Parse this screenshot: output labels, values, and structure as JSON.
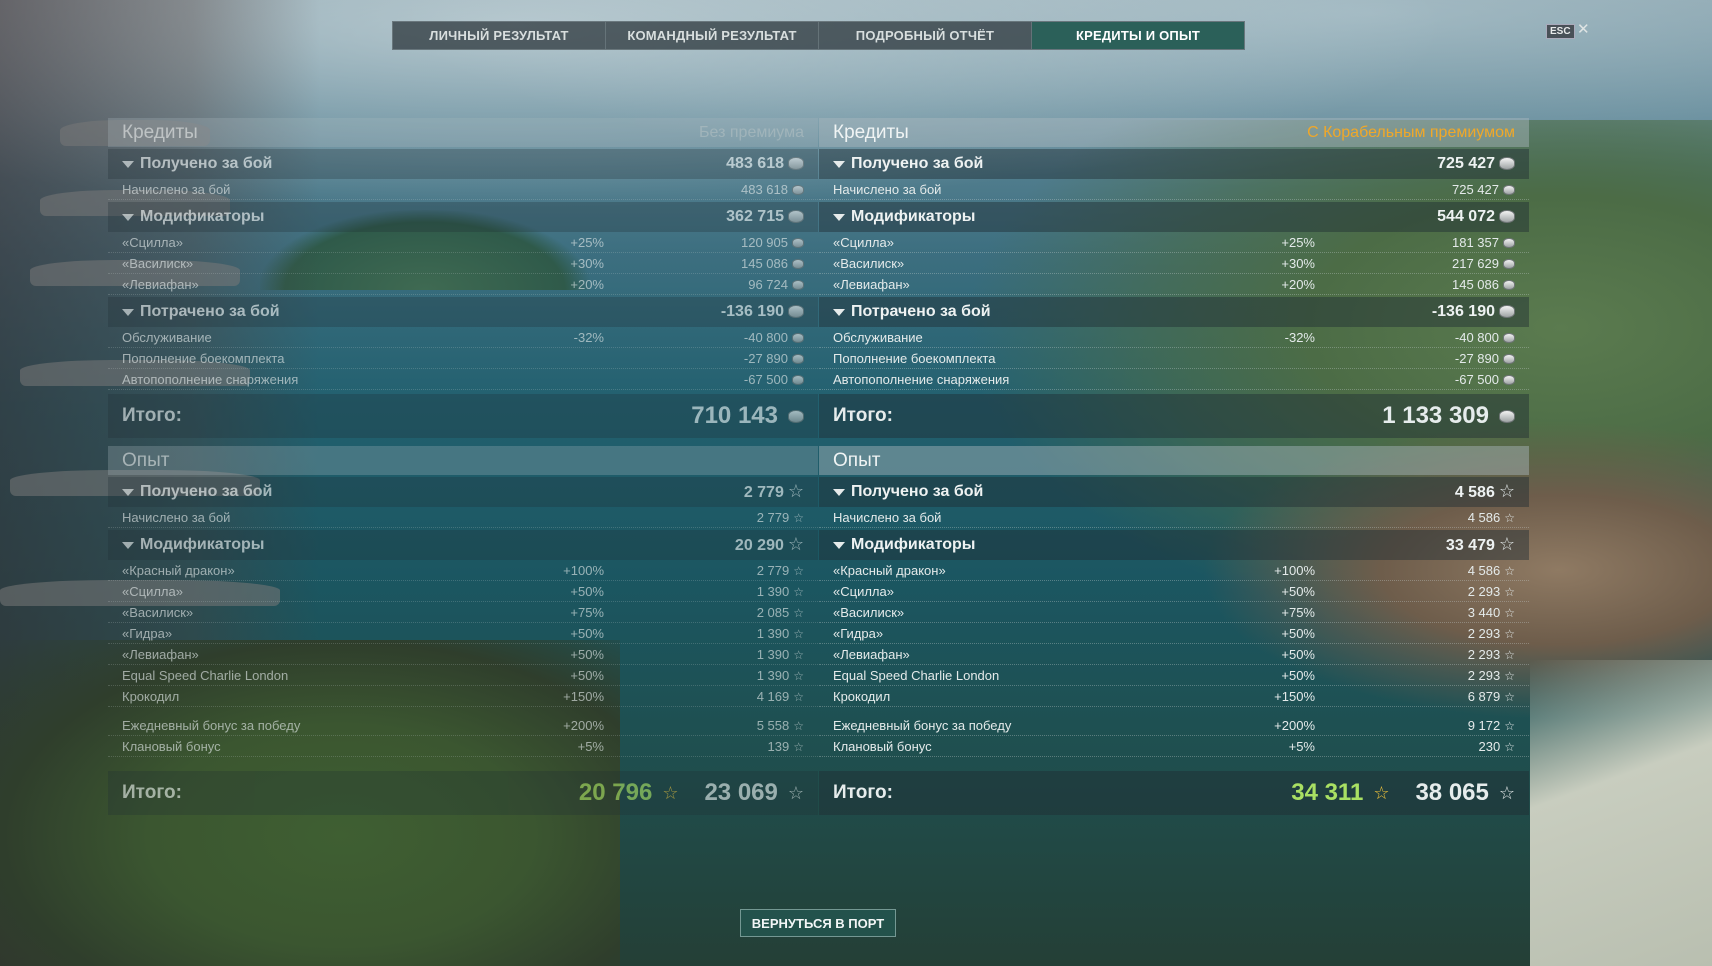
{
  "tabs": [
    "ЛИЧНЫЙ РЕЗУЛЬТАТ",
    "КОМАНДНЫЙ РЕЗУЛЬТАТ",
    "ПОДРОБНЫЙ ОТЧЁТ",
    "КРЕДИТЫ И ОПЫТ"
  ],
  "active_tab": "КРЕДИТЫ И ОПЫТ",
  "esc": "ESC",
  "close": "✕",
  "left": {
    "credits": {
      "title": "Кредиты",
      "badge": "Без премиума",
      "earned": {
        "label": "Получено за бой",
        "value": "483 618",
        "rows": [
          {
            "name": "Начислено за бой",
            "pct": "",
            "value": "483 618"
          }
        ]
      },
      "mods": {
        "label": "Модификаторы",
        "value": "362 715",
        "rows": [
          {
            "name": "«Сцилла»",
            "pct": "+25%",
            "value": "120 905"
          },
          {
            "name": "«Василиск»",
            "pct": "+30%",
            "value": "145 086"
          },
          {
            "name": "«Левиафан»",
            "pct": "+20%",
            "value": "96 724"
          }
        ]
      },
      "spent": {
        "label": "Потрачено за бой",
        "value": "-136 190",
        "rows": [
          {
            "name": "Обслуживание",
            "pct": "-32%",
            "value": "-40 800"
          },
          {
            "name": "Пополнение боекомплекта",
            "pct": "",
            "value": "-27 890"
          },
          {
            "name": "Автопополнение снаряжения",
            "pct": "",
            "value": "-67 500"
          }
        ]
      },
      "total": {
        "label": "Итого:",
        "value": "710 143"
      }
    },
    "xp": {
      "title": "Опыт",
      "earned": {
        "label": "Получено за бой",
        "value": "2 779",
        "rows": [
          {
            "name": "Начислено за бой",
            "pct": "",
            "value": "2 779"
          }
        ]
      },
      "mods": {
        "label": "Модификаторы",
        "value": "20 290",
        "rows": [
          {
            "name": "«Красный дракон»",
            "pct": "+100%",
            "value": "2 779"
          },
          {
            "name": "«Сцилла»",
            "pct": "+50%",
            "value": "1 390"
          },
          {
            "name": "«Василиск»",
            "pct": "+75%",
            "value": "2 085"
          },
          {
            "name": "«Гидра»",
            "pct": "+50%",
            "value": "1 390"
          },
          {
            "name": "«Левиафан»",
            "pct": "+50%",
            "value": "1 390"
          },
          {
            "name": "Equal Speed Charlie London",
            "pct": "+50%",
            "value": "1 390"
          },
          {
            "name": "Крокодил",
            "pct": "+150%",
            "value": "4 169"
          }
        ]
      },
      "bonus": [
        {
          "name": "Ежедневный бонус за победу",
          "pct": "+200%",
          "value": "5 558"
        },
        {
          "name": "Клановый бонус",
          "pct": "+5%",
          "value": "139"
        }
      ],
      "total": {
        "label": "Итого:",
        "free": "20 796",
        "value": "23 069"
      }
    }
  },
  "right": {
    "credits": {
      "title": "Кредиты",
      "badge": "С Корабельным премиумом",
      "earned": {
        "label": "Получено за бой",
        "value": "725 427",
        "rows": [
          {
            "name": "Начислено за бой",
            "pct": "",
            "value": "725 427"
          }
        ]
      },
      "mods": {
        "label": "Модификаторы",
        "value": "544 072",
        "rows": [
          {
            "name": "«Сцилла»",
            "pct": "+25%",
            "value": "181 357"
          },
          {
            "name": "«Василиск»",
            "pct": "+30%",
            "value": "217 629"
          },
          {
            "name": "«Левиафан»",
            "pct": "+20%",
            "value": "145 086"
          }
        ]
      },
      "spent": {
        "label": "Потрачено за бой",
        "value": "-136 190",
        "rows": [
          {
            "name": "Обслуживание",
            "pct": "-32%",
            "value": "-40 800"
          },
          {
            "name": "Пополнение боекомплекта",
            "pct": "",
            "value": "-27 890"
          },
          {
            "name": "Автопополнение снаряжения",
            "pct": "",
            "value": "-67 500"
          }
        ]
      },
      "total": {
        "label": "Итого:",
        "value": "1 133 309"
      }
    },
    "xp": {
      "title": "Опыт",
      "earned": {
        "label": "Получено за бой",
        "value": "4 586",
        "rows": [
          {
            "name": "Начислено за бой",
            "pct": "",
            "value": "4 586"
          }
        ]
      },
      "mods": {
        "label": "Модификаторы",
        "value": "33 479",
        "rows": [
          {
            "name": "«Красный дракон»",
            "pct": "+100%",
            "value": "4 586"
          },
          {
            "name": "«Сцилла»",
            "pct": "+50%",
            "value": "2 293"
          },
          {
            "name": "«Василиск»",
            "pct": "+75%",
            "value": "3 440"
          },
          {
            "name": "«Гидра»",
            "pct": "+50%",
            "value": "2 293"
          },
          {
            "name": "«Левиафан»",
            "pct": "+50%",
            "value": "2 293"
          },
          {
            "name": "Equal Speed Charlie London",
            "pct": "+50%",
            "value": "2 293"
          },
          {
            "name": "Крокодил",
            "pct": "+150%",
            "value": "6 879"
          }
        ]
      },
      "bonus": [
        {
          "name": "Ежедневный бонус за победу",
          "pct": "+200%",
          "value": "9 172"
        },
        {
          "name": "Клановый бонус",
          "pct": "+5%",
          "value": "230"
        }
      ],
      "total": {
        "label": "Итого:",
        "free": "34 311",
        "value": "38 065"
      }
    }
  },
  "back_button": "ВЕРНУТЬСЯ В ПОРТ",
  "colors": {
    "premium_badge": "#f0a829",
    "free_xp": "#a9e063",
    "active_tab": "#266258"
  }
}
